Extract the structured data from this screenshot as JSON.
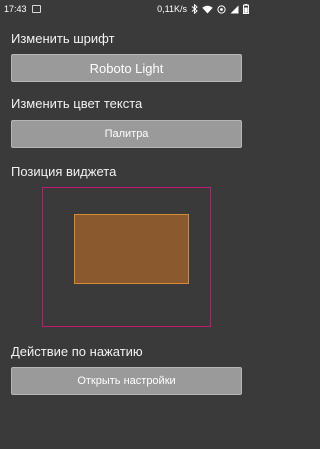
{
  "status_bar": {
    "time": "17:43",
    "speed": "0,11K/s",
    "icons": [
      "notification-icon",
      "bluetooth-icon",
      "wifi-icon",
      "alarm-icon",
      "signal-icon",
      "battery-icon"
    ]
  },
  "font_section": {
    "label": "Изменить шрифт",
    "button_label": "Roboto Light"
  },
  "color_section": {
    "label": "Изменить цвет текста",
    "button_label": "Палитра"
  },
  "position_section": {
    "label": "Позиция виджета",
    "frame_color": "#c21a74",
    "widget_color": "#8a5a2e",
    "widget_border_color": "#d58a34"
  },
  "action_section": {
    "label": "Действие по нажатию",
    "button_label": "Открыть настройки"
  },
  "colors": {
    "background": "#3a3a3a",
    "button": "#9a9a9a"
  }
}
